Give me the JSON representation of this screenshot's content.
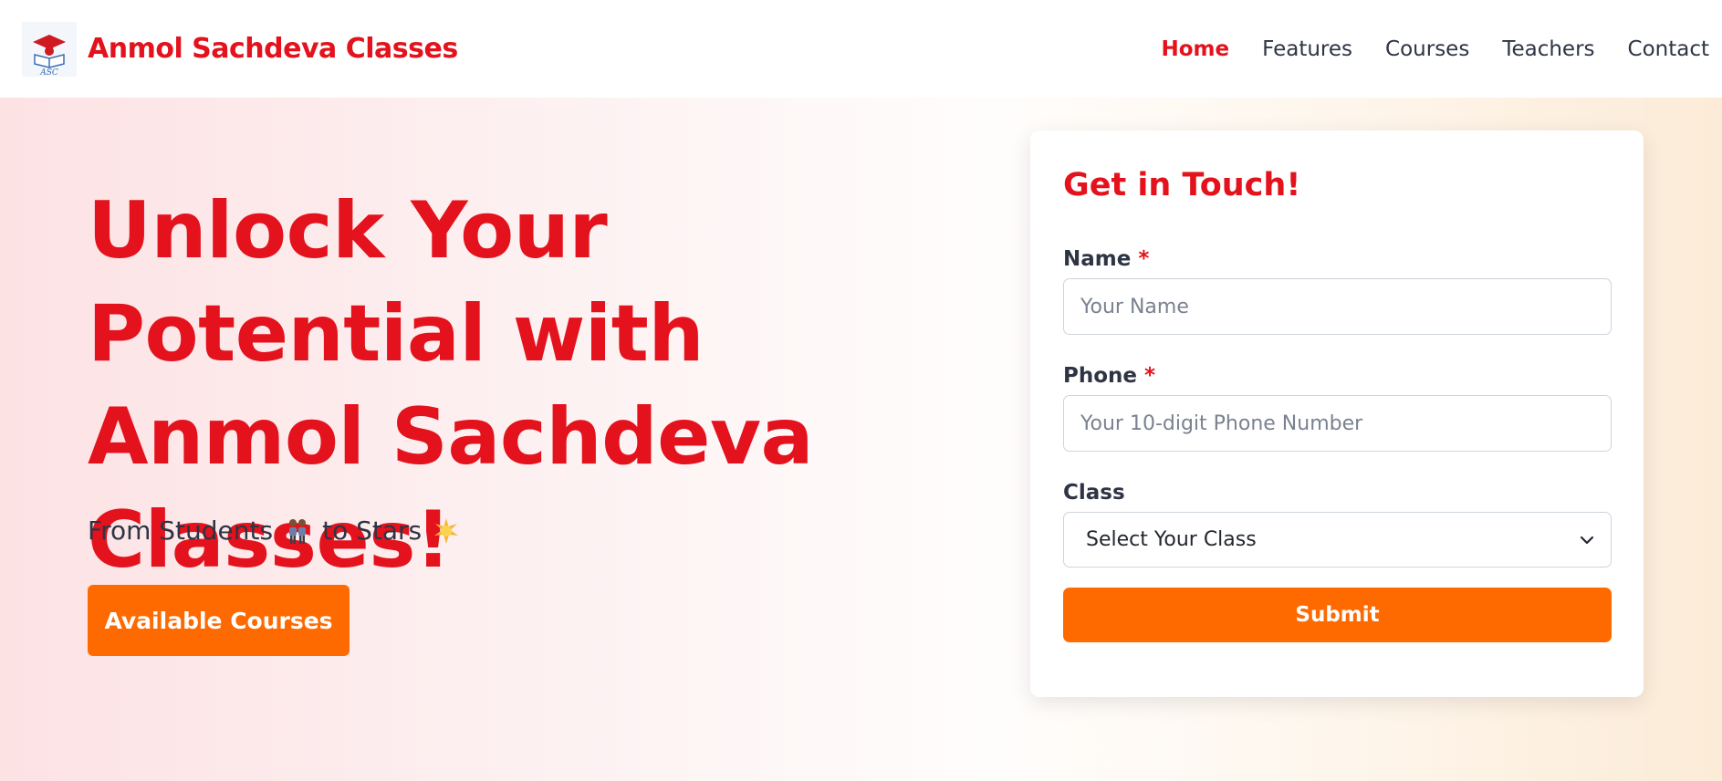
{
  "header": {
    "logo_text": "ASC",
    "brand": "Anmol Sachdeva Classes",
    "nav": [
      {
        "label": "Home",
        "active": true
      },
      {
        "label": "Features",
        "active": false
      },
      {
        "label": "Courses",
        "active": false
      },
      {
        "label": "Teachers",
        "active": false
      },
      {
        "label": "Contact",
        "active": false
      }
    ]
  },
  "hero": {
    "title": "Unlock Your Potential with Anmol Sachdeva Classes!",
    "subtitle_part1": "From Students",
    "subtitle_part2": "to Stars",
    "subtitle_icons": [
      "students-icon",
      "star-icon"
    ],
    "cta_label": "Available Courses"
  },
  "form": {
    "title": "Get in Touch!",
    "name_label": "Name",
    "name_placeholder": "Your Name",
    "phone_label": "Phone",
    "phone_placeholder": "Your 10-digit Phone Number",
    "required_mark": "*",
    "class_label": "Class",
    "class_selected": "Select Your Class",
    "submit_label": "Submit"
  },
  "colors": {
    "brand_red": "#e3121c",
    "accent_orange": "#ff6a00",
    "text_dark": "#2e3444"
  }
}
